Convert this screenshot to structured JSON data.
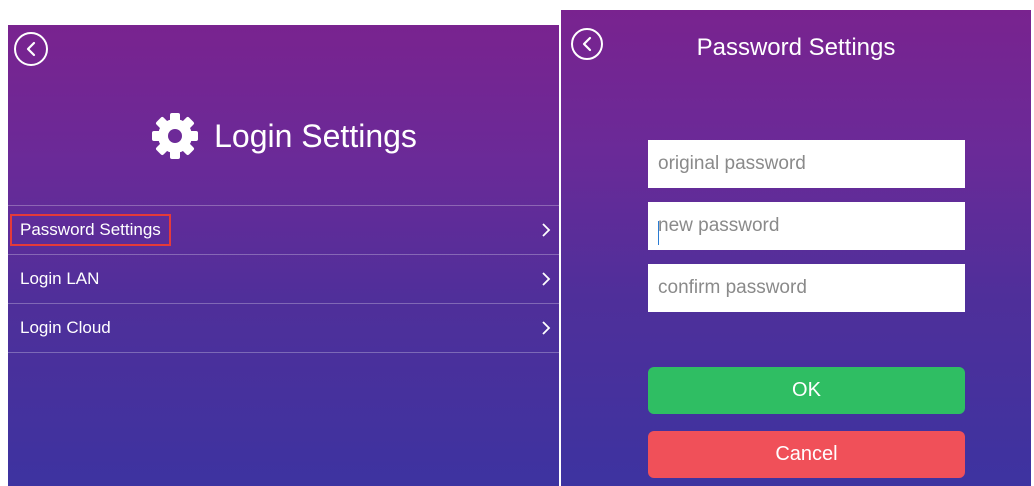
{
  "login_screen": {
    "title": "Login Settings",
    "icons": {
      "back": "back-arrow-circle-icon",
      "title": "gear-icon",
      "item_arrow": "chevron-right-icon"
    },
    "menu": [
      {
        "label": "Password Settings",
        "highlighted": true
      },
      {
        "label": "Login LAN"
      },
      {
        "label": "Login Cloud"
      }
    ]
  },
  "password_screen": {
    "title": "Password Settings",
    "fields": {
      "original": {
        "placeholder": "original password"
      },
      "new": {
        "placeholder": "new password",
        "focused": true
      },
      "confirm": {
        "placeholder": "confirm password"
      }
    },
    "ok_label": "OK",
    "cancel_label": "Cancel"
  },
  "colors": {
    "background_top": "#79238f",
    "background_bottom": "#3d33a0",
    "ok": "#2fbe63",
    "cancel": "#f05059",
    "highlight": "#e53a3a"
  }
}
